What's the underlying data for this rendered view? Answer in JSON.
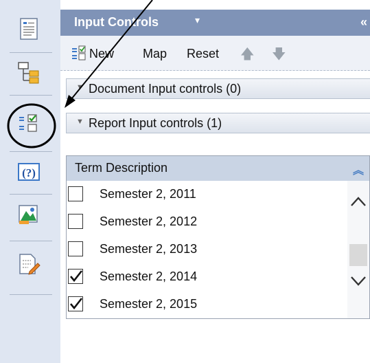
{
  "panel": {
    "title": "Input Controls",
    "title_caret": "▾",
    "collapse": "«"
  },
  "toolbar": {
    "new_label": "New",
    "map_label": "Map",
    "reset_label": "Reset"
  },
  "sections": {
    "document": {
      "label": "Document Input controls (0)"
    },
    "report": {
      "label": "Report Input controls (1)"
    }
  },
  "list": {
    "header": "Term Description",
    "items": [
      {
        "label": "Semester 2, 2011",
        "checked": false
      },
      {
        "label": "Semester 2, 2012",
        "checked": false
      },
      {
        "label": "Semester 2, 2013",
        "checked": false
      },
      {
        "label": "Semester 2, 2014",
        "checked": true
      },
      {
        "label": "Semester 2, 2015",
        "checked": true
      }
    ]
  },
  "leftbar": {
    "icons": [
      "document-structure-icon",
      "hierarchy-icon",
      "input-controls-icon",
      "help-icon",
      "chart-image-icon",
      "edit-document-icon"
    ]
  },
  "colors": {
    "header": "#7f93b7",
    "sidebar": "#dfe6f2",
    "list_header": "#c9d4e4"
  }
}
